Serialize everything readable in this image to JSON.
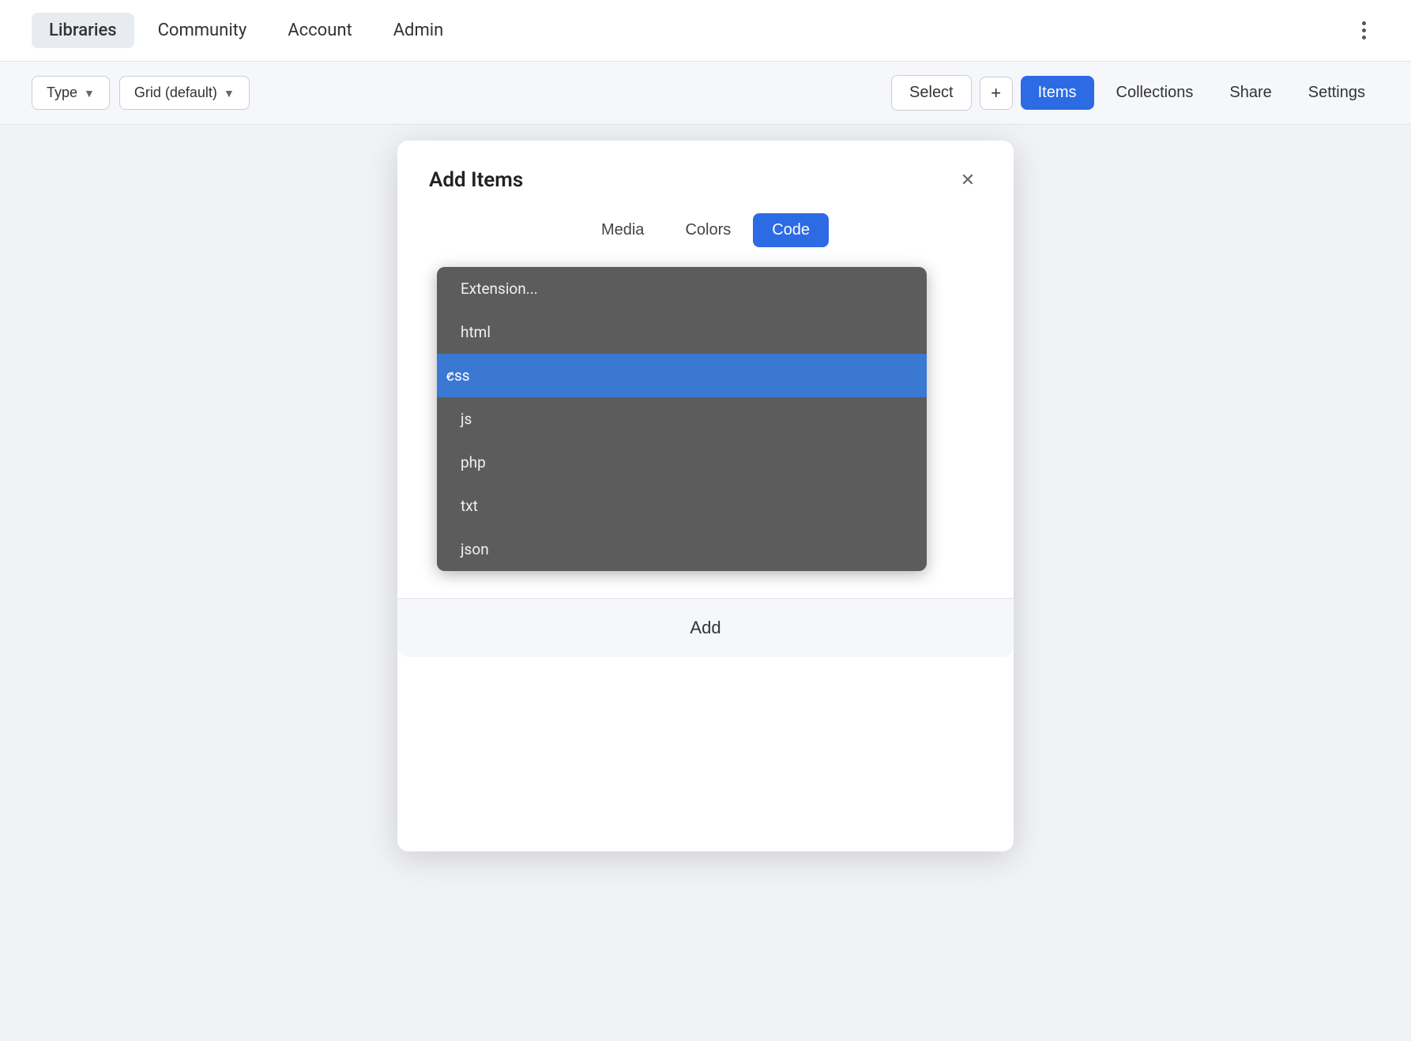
{
  "nav": {
    "items": [
      {
        "id": "libraries",
        "label": "Libraries",
        "active": true
      },
      {
        "id": "community",
        "label": "Community",
        "active": false
      },
      {
        "id": "account",
        "label": "Account",
        "active": false
      },
      {
        "id": "admin",
        "label": "Admin",
        "active": false
      }
    ]
  },
  "toolbar": {
    "type_label": "Type",
    "grid_label": "Grid (default)",
    "select_label": "Select",
    "add_label": "+",
    "items_label": "Items",
    "collections_label": "Collections",
    "share_label": "Share",
    "settings_label": "Settings"
  },
  "modal": {
    "title": "Add Items",
    "tabs": [
      {
        "id": "media",
        "label": "Media",
        "active": false
      },
      {
        "id": "colors",
        "label": "Colors",
        "active": false
      },
      {
        "id": "code",
        "label": "Code",
        "active": true
      }
    ],
    "dropdown": {
      "items": [
        {
          "id": "extension",
          "label": "Extension...",
          "selected": false,
          "check": false
        },
        {
          "id": "html",
          "label": "html",
          "selected": false,
          "check": false
        },
        {
          "id": "css",
          "label": "css",
          "selected": true,
          "check": true
        },
        {
          "id": "js",
          "label": "js",
          "selected": false,
          "check": false
        },
        {
          "id": "php",
          "label": "php",
          "selected": false,
          "check": false
        },
        {
          "id": "txt",
          "label": "txt",
          "selected": false,
          "check": false
        },
        {
          "id": "json",
          "label": "json",
          "selected": false,
          "check": false
        }
      ]
    },
    "add_button_label": "Add"
  }
}
